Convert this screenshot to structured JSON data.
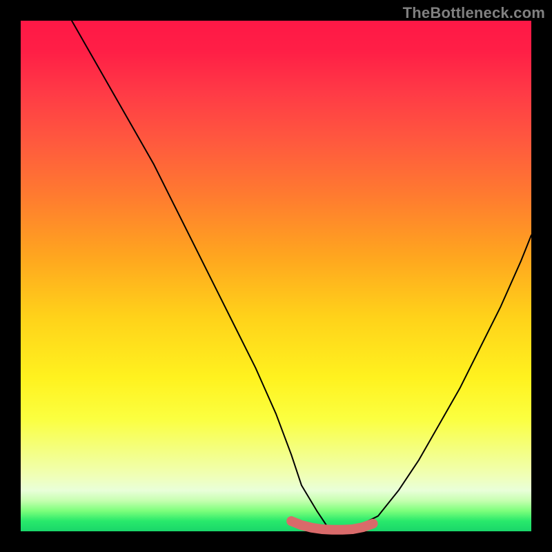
{
  "watermark": "TheBottleneck.com",
  "colors": {
    "frame": "#000000",
    "curve": "#000000",
    "bottom_marker": "#d96a6a",
    "gradient_stops": [
      "#ff1846",
      "#ff1f46",
      "#ff3a46",
      "#ff5a3e",
      "#ff7a30",
      "#ffa51f",
      "#ffd21a",
      "#fff21f",
      "#fbff40",
      "#f4ff80",
      "#f0ffb5",
      "#e9ffd9",
      "#c6ffb0",
      "#7dff7c",
      "#28e96b",
      "#1ad66a"
    ]
  },
  "chart_data": {
    "type": "line",
    "title": "",
    "xlabel": "",
    "ylabel": "",
    "xlim": [
      0,
      100
    ],
    "ylim": [
      0,
      100
    ],
    "series": [
      {
        "name": "curve",
        "x": [
          10,
          14,
          18,
          22,
          26,
          30,
          34,
          38,
          42,
          46,
          50,
          53,
          55,
          58,
          60,
          63,
          66,
          70,
          74,
          78,
          82,
          86,
          90,
          94,
          98,
          100
        ],
        "values": [
          100,
          93,
          86,
          79,
          72,
          64,
          56,
          48,
          40,
          32,
          23,
          15,
          9,
          4,
          1,
          0,
          1,
          3,
          8,
          14,
          21,
          28,
          36,
          44,
          53,
          58
        ]
      },
      {
        "name": "bottom-marker",
        "x": [
          53,
          55,
          57,
          59,
          61,
          63,
          65,
          67,
          69
        ],
        "values": [
          2,
          1.2,
          0.7,
          0.4,
          0.3,
          0.3,
          0.4,
          0.8,
          1.5
        ]
      }
    ]
  }
}
